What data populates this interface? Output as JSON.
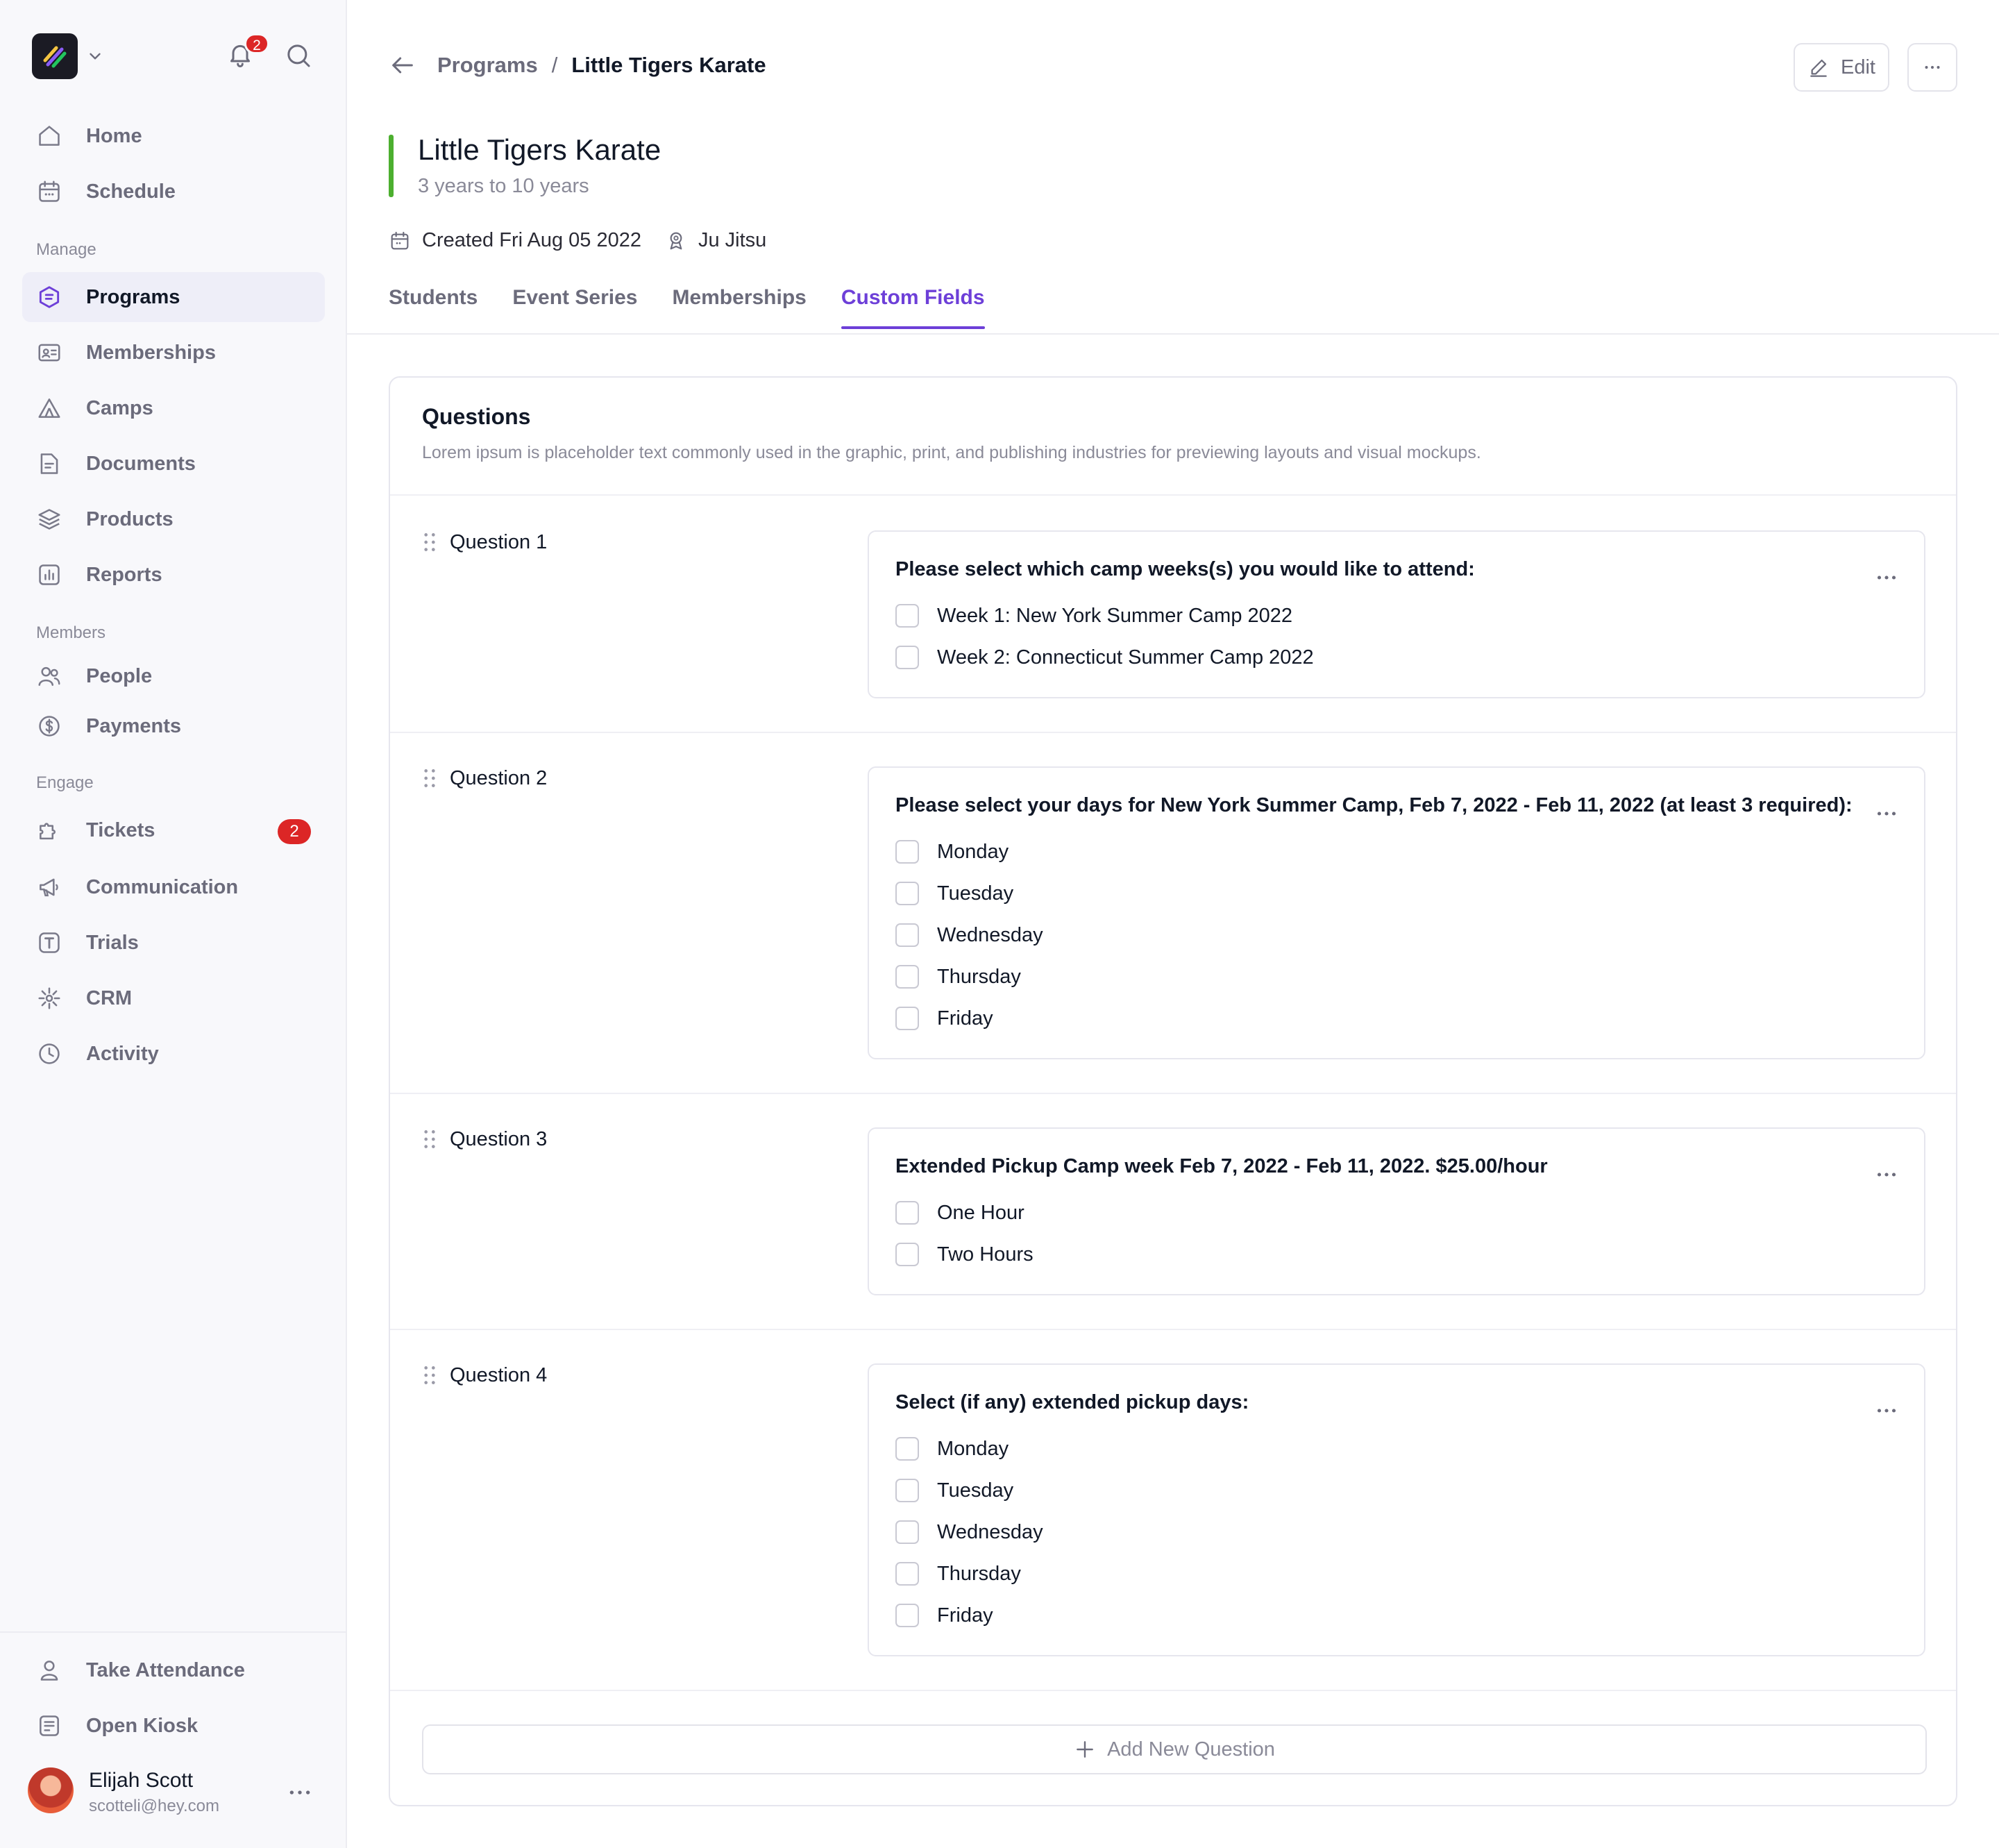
{
  "sidebar": {
    "notification_count": "2",
    "sections": {
      "manage": "Manage",
      "members": "Members",
      "engage": "Engage"
    },
    "items": {
      "home": "Home",
      "schedule": "Schedule",
      "programs": "Programs",
      "memberships": "Memberships",
      "camps": "Camps",
      "documents": "Documents",
      "products": "Products",
      "reports": "Reports",
      "people": "People",
      "payments": "Payments",
      "tickets": "Tickets",
      "tickets_badge": "2",
      "communication": "Communication",
      "trials": "Trials",
      "crm": "CRM",
      "activity": "Activity",
      "take_attendance": "Take Attendance",
      "open_kiosk": "Open Kiosk"
    },
    "user": {
      "name": "Elijah Scott",
      "email": "scotteli@hey.com"
    }
  },
  "header": {
    "breadcrumb_parent": "Programs",
    "breadcrumb_sep": "/",
    "breadcrumb_current": "Little Tigers Karate",
    "edit_label": "Edit"
  },
  "program": {
    "title": "Little Tigers Karate",
    "subtitle": "3 years to 10 years",
    "created": "Created Fri Aug 05 2022",
    "instructor": "Ju Jitsu",
    "accent_color": "#4caf2f"
  },
  "tabs": {
    "students": "Students",
    "event_series": "Event Series",
    "memberships": "Memberships",
    "custom_fields": "Custom Fields",
    "active_color": "#6d3fd8"
  },
  "questions_card": {
    "title": "Questions",
    "description": "Lorem ipsum is placeholder text commonly used in the graphic, print, and publishing industries for previewing layouts and visual mockups.",
    "add_label": "Add New Question",
    "questions": [
      {
        "label": "Question 1",
        "text": "Please select which camp weeks(s) you would like to attend:",
        "options": [
          "Week 1: New York Summer Camp 2022",
          "Week 2: Connecticut Summer Camp 2022"
        ]
      },
      {
        "label": "Question 2",
        "text": "Please select your days for New York Summer Camp, Feb 7, 2022 - Feb 11, 2022 (at least 3 required):",
        "options": [
          "Monday",
          "Tuesday",
          "Wednesday",
          "Thursday",
          "Friday"
        ]
      },
      {
        "label": "Question 3",
        "text": "Extended Pickup Camp week Feb 7, 2022 - Feb 11, 2022. $25.00/hour",
        "options": [
          "One Hour",
          "Two Hours"
        ]
      },
      {
        "label": "Question 4",
        "text": "Select (if any) extended pickup days:",
        "options": [
          "Monday",
          "Tuesday",
          "Wednesday",
          "Thursday",
          "Friday"
        ]
      }
    ]
  }
}
